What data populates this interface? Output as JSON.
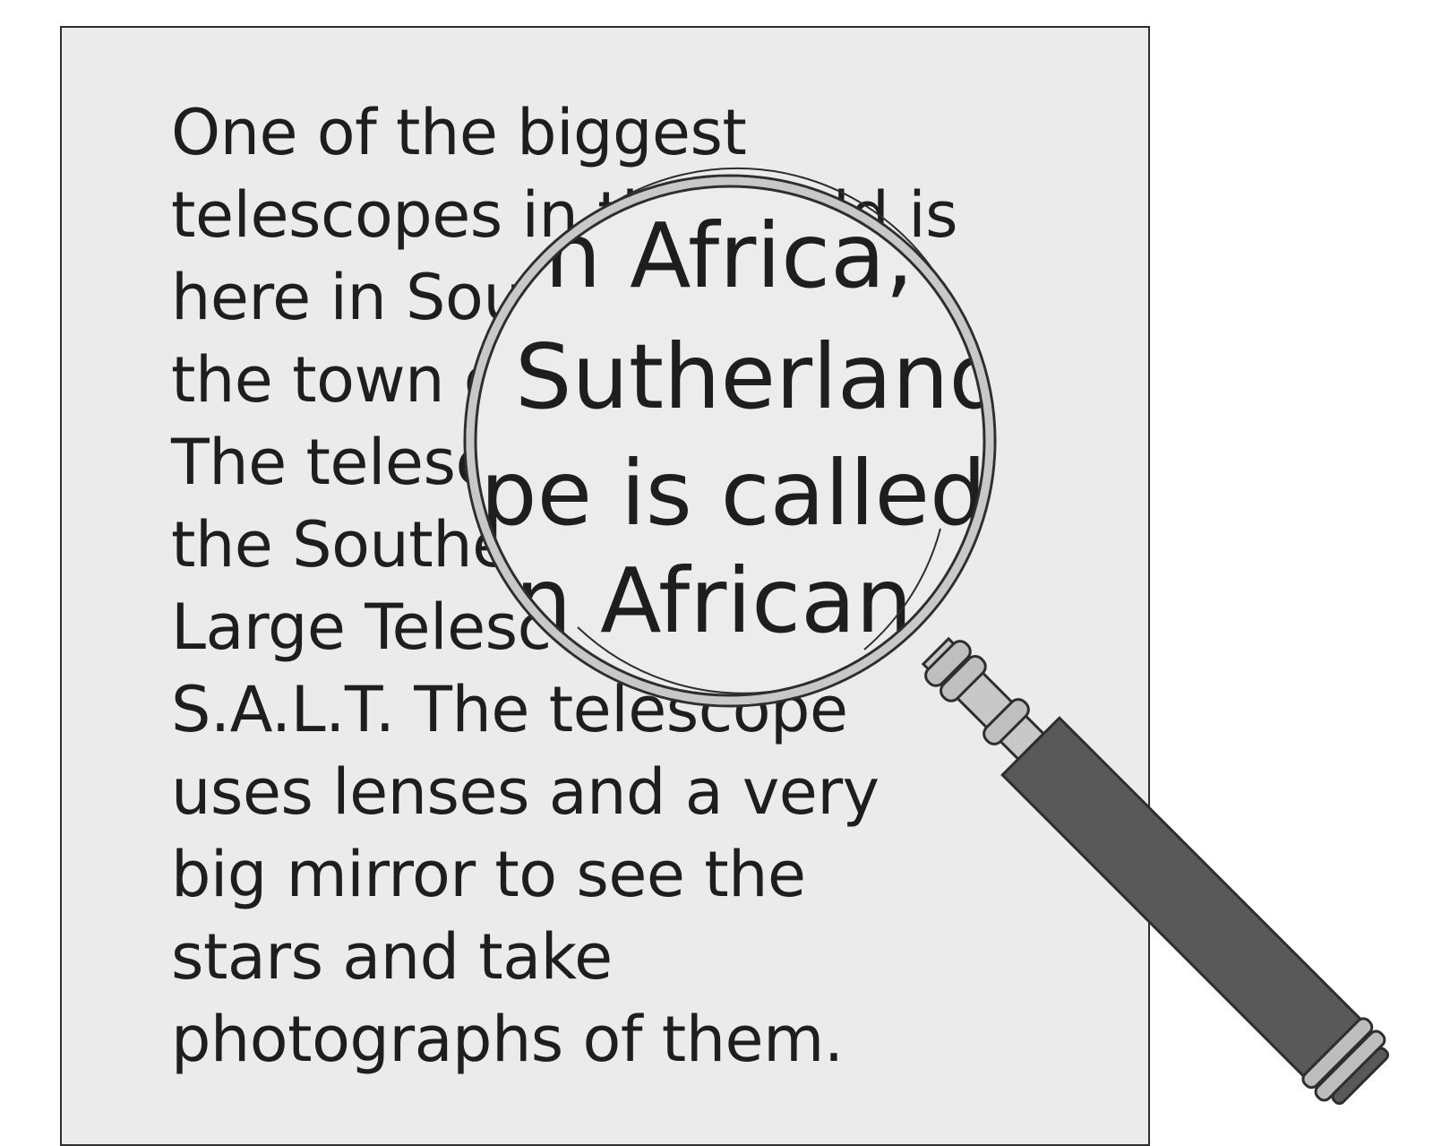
{
  "document": {
    "lines": [
      "One of the biggest",
      "telescopes in the world is",
      "here in South Africa, in",
      "the town of Sutherland.",
      "The telescope is called",
      "the Southern African",
      "Large Telescope, or",
      "S.A.L.T. The telescope",
      "uses lenses and a very",
      "big mirror to see the",
      "stars and take",
      "photographs of them."
    ]
  },
  "magnifier": {
    "lens_lines": [
      "n Africa, i",
      "Sutherland",
      "ope is called",
      "n African"
    ]
  },
  "colors": {
    "paper": "#ebebeb",
    "ink": "#1e1e1e",
    "handle": "#595959",
    "ferrule": "#c8c8c8"
  }
}
